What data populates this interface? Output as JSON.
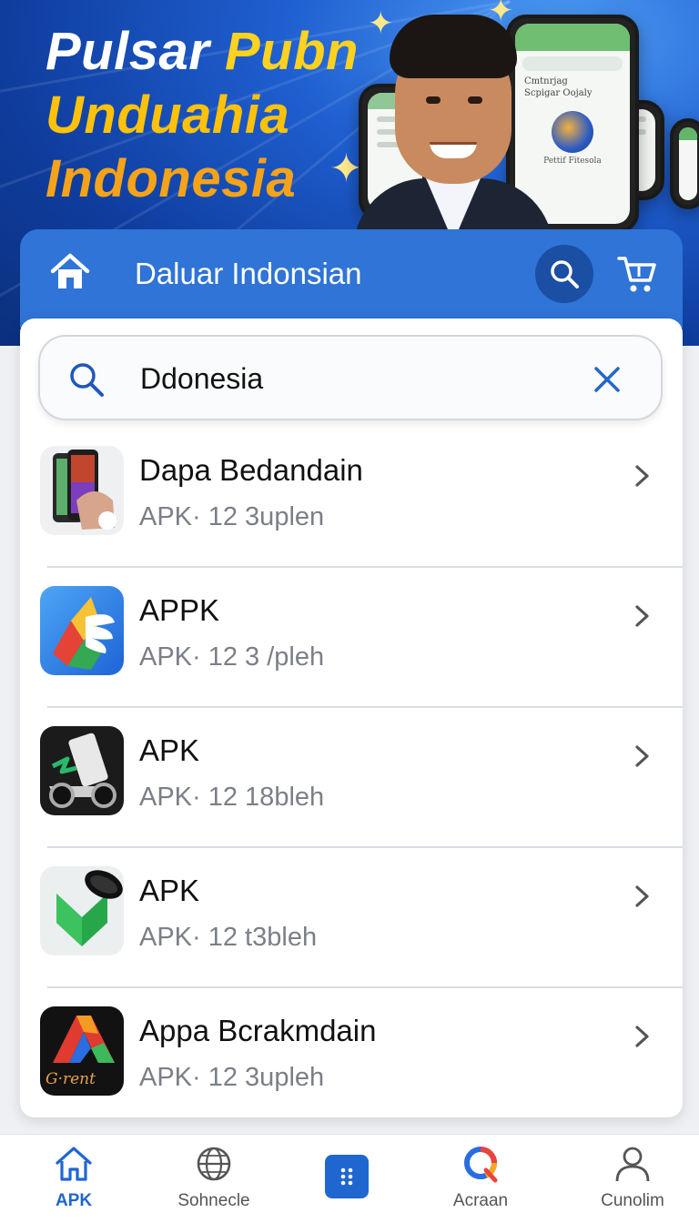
{
  "hero": {
    "title_line1_a": "Pulsar",
    "title_line1_b": "Pubn",
    "title_line2": "Unduahia",
    "title_line3": "Indonesia",
    "phone_text_1": "Cmtnrjag",
    "phone_text_2": "Scpigar Oojaly",
    "phone_text_3": "Pettif Fitesola"
  },
  "header": {
    "title": "Daluar Indonsian",
    "home_icon": "home-icon",
    "search_icon": "search-icon",
    "cart_icon": "cart-icon"
  },
  "search": {
    "value": "Ddonesia",
    "search_icon": "search-icon",
    "clear_icon": "close-icon"
  },
  "apps": [
    {
      "name": "Dapa Bedandain",
      "meta": "APK· 12 3uplen",
      "icon": "phones-app-icon"
    },
    {
      "name": "APPK",
      "meta": "APK· 12 3 /pleh",
      "icon": "google-drive-style-icon"
    },
    {
      "name": "APK",
      "meta": "APK· 12 18bleh",
      "icon": "vehicle-app-icon"
    },
    {
      "name": "APK",
      "meta": "APK· 12 t3bleh",
      "icon": "green-download-icon"
    },
    {
      "name": "Appa Bcrakmdain",
      "meta": "APK· 12 3upleh",
      "icon": "g-rent-app-icon",
      "icon_text": "G·rent"
    }
  ],
  "nav": [
    {
      "label": "APK",
      "icon": "home-icon",
      "active": true
    },
    {
      "label": "Sohnecle",
      "icon": "globe-icon",
      "active": false
    },
    {
      "label": "",
      "icon": "apps-grid-icon",
      "active": false
    },
    {
      "label": "Acraan",
      "icon": "colorful-q-icon",
      "active": false
    },
    {
      "label": "Cunolim",
      "icon": "user-icon",
      "active": false
    }
  ],
  "colors": {
    "primary": "#2f74d6",
    "primary_dark": "#1a4fa3",
    "hero_yellow": "#ffc20a",
    "meta_gray": "#7b7f87"
  }
}
